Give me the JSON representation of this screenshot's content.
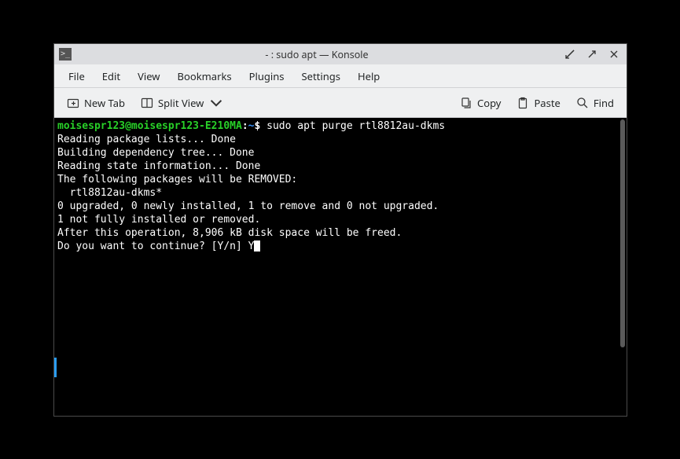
{
  "window": {
    "title": "- : sudo apt — Konsole"
  },
  "menubar": {
    "file": "File",
    "edit": "Edit",
    "view": "View",
    "bookmarks": "Bookmarks",
    "plugins": "Plugins",
    "settings": "Settings",
    "help": "Help"
  },
  "toolbar": {
    "new_tab": "New Tab",
    "split_view": "Split View",
    "copy": "Copy",
    "paste": "Paste",
    "find": "Find"
  },
  "terminal": {
    "prompt_userhost": "moisespr123@moisespr123-E210MA",
    "prompt_colon": ":",
    "prompt_path": "~",
    "prompt_dollar": "$",
    "command": " sudo apt purge rtl8812au-dkms",
    "lines": {
      "l1": "Reading package lists... Done",
      "l2": "Building dependency tree... Done",
      "l3": "Reading state information... Done",
      "l4": "The following packages will be REMOVED:",
      "l5": "  rtl8812au-dkms*",
      "l6": "0 upgraded, 0 newly installed, 1 to remove and 0 not upgraded.",
      "l7": "1 not fully installed or removed.",
      "l8": "After this operation, 8,906 kB disk space will be freed.",
      "l9": "Do you want to continue? [Y/n] Y"
    }
  }
}
